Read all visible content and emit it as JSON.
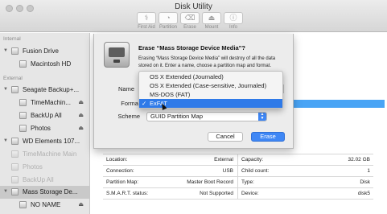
{
  "window": {
    "title": "Disk Utility"
  },
  "toolbar": {
    "buttons": [
      {
        "label": "First Aid",
        "icon": "stethoscope-icon",
        "glyph": "⚕"
      },
      {
        "label": "Partition",
        "icon": "partition-icon",
        "glyph": "◔"
      },
      {
        "label": "Erase",
        "icon": "erase-icon",
        "glyph": "⌫"
      },
      {
        "label": "Mount",
        "icon": "mount-icon",
        "glyph": "⏏"
      },
      {
        "label": "Info",
        "icon": "info-icon",
        "glyph": "ⓘ"
      }
    ]
  },
  "sidebar": {
    "sections": {
      "internal": "Internal",
      "external": "External"
    },
    "items": [
      {
        "label": "Fusion Drive"
      },
      {
        "label": "Macintosh HD"
      },
      {
        "label": "Seagate Backup+..."
      },
      {
        "label": "TimeMachin...",
        "eject": "⏏"
      },
      {
        "label": "BackUp All",
        "eject": "⏏"
      },
      {
        "label": "Photos",
        "eject": "⏏"
      },
      {
        "label": "WD Elements 107..."
      },
      {
        "label": "TimeMachine Main"
      },
      {
        "label": "Photos"
      },
      {
        "label": "BackUp All"
      },
      {
        "label": "Mass Storage De..."
      },
      {
        "label": "NO NAME",
        "eject": "⏏"
      }
    ]
  },
  "dialog": {
    "title": "Erase “Mass Storage Device Media”?",
    "body": "Erasing “Mass Storage Device Media” will destroy of all the data stored on it. Enter a name, choose a partition map and format.",
    "name_label": "Name",
    "format_label": "Format",
    "scheme_label": "Scheme",
    "scheme_value": "GUID Partition Map",
    "cancel_label": "Cancel",
    "erase_label": "Erase",
    "accent": "#3f87f5"
  },
  "format_menu": {
    "options": [
      "OS X Extended (Journaled)",
      "OS X Extended (Case-sensitive, Journaled)",
      "MS-DOS (FAT)",
      "ExFAT"
    ],
    "selected": "ExFAT",
    "check": "✓"
  },
  "info": {
    "rows": [
      {
        "k1": "Location:",
        "v1": "External",
        "k2": "Capacity:",
        "v2": "32.02 GB"
      },
      {
        "k1": "Connection:",
        "v1": "USB",
        "k2": "Child count:",
        "v2": "1"
      },
      {
        "k1": "Partition Map:",
        "v1": "Master Boot Record",
        "k2": "Type:",
        "v2": "Disk"
      },
      {
        "k1": "S.M.A.R.T. status:",
        "v1": "Not Supported",
        "k2": "Device:",
        "v2": "disk5"
      }
    ]
  }
}
